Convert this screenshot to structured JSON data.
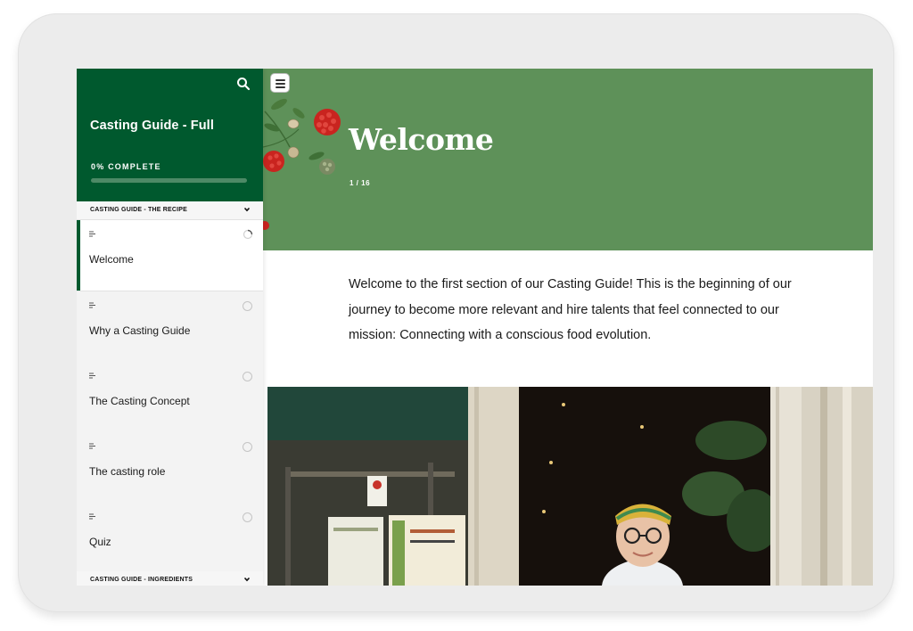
{
  "sidebar": {
    "course_title": "Casting Guide - Full",
    "progress_label": "0% COMPLETE",
    "progress_fraction": 0.0,
    "sections": [
      {
        "label": "CASTING GUIDE - THE RECIPE",
        "lessons": [
          {
            "title": "Welcome",
            "active": true,
            "status": "in-progress"
          },
          {
            "title": "Why a Casting Guide",
            "active": false,
            "status": "not-started"
          },
          {
            "title": "The Casting Concept",
            "active": false,
            "status": "not-started"
          },
          {
            "title": "The casting role",
            "active": false,
            "status": "not-started"
          },
          {
            "title": "Quiz",
            "active": false,
            "status": "not-started"
          }
        ]
      },
      {
        "label": "CASTING GUIDE - INGREDIENTS",
        "lessons": []
      }
    ]
  },
  "hero": {
    "title": "Welcome",
    "page_indicator": "1 / 16"
  },
  "intro": {
    "text": "Welcome to the first section of our Casting Guide! This is the beginning of our journey to become more relevant and hire talents that feel connected to our mission: Connecting with a conscious food evolution."
  },
  "icons": {
    "search": "search-icon",
    "menu": "hamburger-menu-icon",
    "chevron": "chevron-down-icon",
    "lesson_type": "text-lines-icon"
  },
  "colors": {
    "brand_green": "#00592e",
    "hero_green": "#5e9159",
    "sidebar_bg": "#f3f3f3"
  }
}
